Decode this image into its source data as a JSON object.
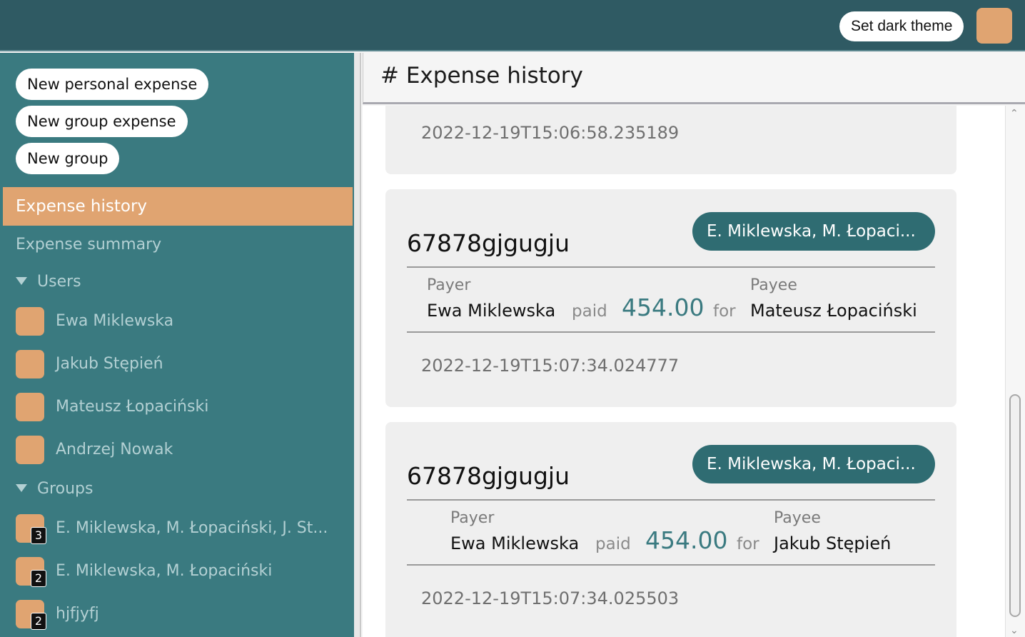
{
  "topbar": {
    "theme_button": "Set dark theme"
  },
  "sidebar": {
    "buttons": {
      "new_personal": "New personal expense",
      "new_group_expense": "New group expense",
      "new_group": "New group"
    },
    "nav": {
      "history": "Expense history",
      "summary": "Expense summary"
    },
    "users_section": "Users",
    "users": [
      "Ewa Miklewska",
      "Jakub Stępień",
      "Mateusz Łopaciński",
      "Andrzej Nowak"
    ],
    "groups_section": "Groups",
    "groups": [
      {
        "name": "E. Miklewska, M. Łopaciński, J. St...",
        "count": "3"
      },
      {
        "name": "E. Miklewska, M. Łopaciński",
        "count": "2"
      },
      {
        "name": "hjfjyfj",
        "count": "2"
      }
    ]
  },
  "main": {
    "title": "# Expense history",
    "expenses": [
      {
        "timestamp": "2022-12-19T15:06:58.235189"
      },
      {
        "title": "67878gjgugju",
        "group": "E. Miklewska, M. Łopaci...",
        "payer_label": "Payer",
        "payer": "Ewa Miklewska",
        "paid_word": "paid",
        "amount": "454.00",
        "for_word": "for",
        "payee_label": "Payee",
        "payee": "Mateusz Łopaciński",
        "timestamp": "2022-12-19T15:07:34.024777"
      },
      {
        "title": "67878gjgugju",
        "group": "E. Miklewska, M. Łopaci...",
        "payer_label": "Payer",
        "payer": "Ewa Miklewska",
        "paid_word": "paid",
        "amount": "454.00",
        "for_word": "for",
        "payee_label": "Payee",
        "payee": "Jakub Stępień",
        "timestamp": "2022-12-19T15:07:34.025503"
      }
    ]
  },
  "colors": {
    "topbar": "#2f5a63",
    "sidebar": "#3a7a80",
    "accent": "#e0a471",
    "group_pill": "#2f6c72"
  }
}
